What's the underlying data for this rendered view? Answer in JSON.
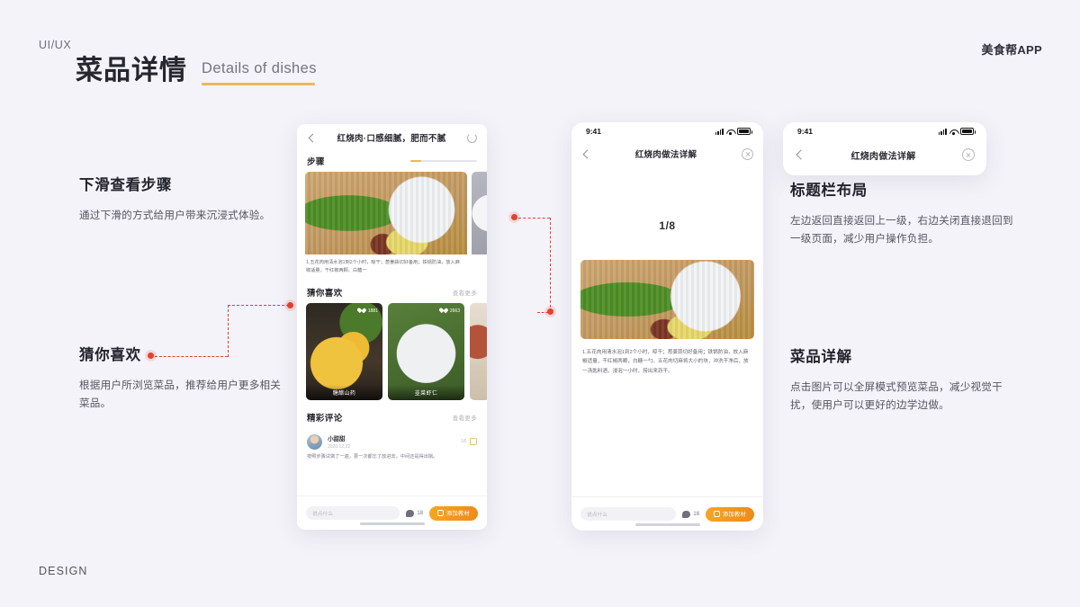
{
  "header": {
    "kicker": "UI/UX",
    "brand": "美食帮APP",
    "title_cn": "菜品详情",
    "title_en": "Details of dishes",
    "footer": "DESIGN",
    "accent_underline": "#e8b860",
    "accent_marker": "#e8402a",
    "background": "#f4f3f9"
  },
  "notes": [
    {
      "id": "note-scroll-steps",
      "heading": "下滑查看步骤",
      "body": "通过下滑的方式给用户带来沉浸式体验。"
    },
    {
      "id": "note-guess-you-like",
      "heading": "猜你喜欢",
      "body": "根据用户所浏览菜品，推荐给用户更多相关菜品。"
    },
    {
      "id": "note-titlebar-layout",
      "heading": "标题栏布局",
      "body": "左边返回直接返回上一级，右边关闭直接退回到一级页面，减少用户操作负担。"
    },
    {
      "id": "note-dish-detail",
      "heading": "菜品详解",
      "body": "点击图片可以全屏模式预览菜品，减少视觉干扰，使用户可以更好的边学边做。"
    }
  ],
  "phone1": {
    "nav_title": "红烧肉·口感细腻，肥而不腻",
    "section_steps": "步骤",
    "step_text": "1.五花肉用清水泡1到2个小时，晾干；葱姜蒜切好备用；铁锅防油，放入麻椒适量，干红椒两颗、白糖一",
    "section_recommend": "猜你喜欢",
    "more_label": "查看更多",
    "cards": [
      {
        "caption": "糖醋山药",
        "likes": "1881"
      },
      {
        "caption": "韭菜虾仁",
        "likes": "2663"
      }
    ],
    "section_comments": "精彩评论",
    "comment": {
      "name": "小甜甜",
      "date": "2020.12.22",
      "likes": "18",
      "text": "按照步骤试做了一遍，蔥一次都忘了放进去，中间还是得出锅。"
    },
    "bottom": {
      "input_placeholder": "说点什么",
      "comment_count": "18",
      "cta_label": "添加教材"
    }
  },
  "phone2": {
    "status_time": "9:41",
    "nav_title": "红烧肉做法详解",
    "page_counter": "1/8",
    "recipe_text": "1.五花肉用清水泡1到2个小时，晾干；葱姜蒜切好备用；铁锅防油，放入麻椒适量，干红椒两颗，白糖一勺。五花肉切麻将大小的块，冲洗干净后，放一汤匙料酒，浸泡一小时，捞出来沥干。",
    "bottom": {
      "input_placeholder": "说点什么",
      "comment_count": "18",
      "cta_label": "添加教材"
    }
  },
  "phone3": {
    "status_time": "9:41",
    "nav_title": "红烧肉做法详解"
  }
}
